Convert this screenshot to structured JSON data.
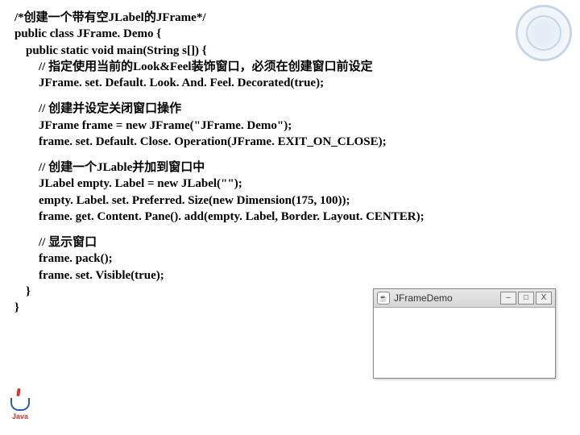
{
  "lines": {
    "l1": "/*创建一个带有空JLabel的JFrame*/",
    "l2": "public class JFrame. Demo {",
    "l3": "public static void main(String s[]) {",
    "c1": "// 指定使用当前的Look&Feel装饰窗口，必须在创建窗口前设定",
    "l4": "JFrame. set. Default. Look. And. Feel. Decorated(true);",
    "c2": "// 创建并设定关闭窗口操作",
    "l5": "JFrame frame = new JFrame(\"JFrame. Demo\");",
    "l6": "frame. set. Default. Close. Operation(JFrame. EXIT_ON_CLOSE);",
    "c3": "// 创建一个JLable并加到窗口中",
    "l7": "JLabel empty. Label = new JLabel(\"\");",
    "l8": "empty. Label. set. Preferred. Size(new Dimension(175, 100));",
    "l9": "frame. get. Content. Pane(). add(empty. Label, Border. Layout. CENTER);",
    "c4": "// 显示窗口",
    "l10": "frame. pack();",
    "l11": "frame. set. Visible(true);",
    "brace1": "}",
    "brace2": "}"
  },
  "miniwindow": {
    "title": "JFrameDemo",
    "min": "–",
    "max": "□",
    "close": "X"
  },
  "logo": {
    "text": "Java"
  }
}
